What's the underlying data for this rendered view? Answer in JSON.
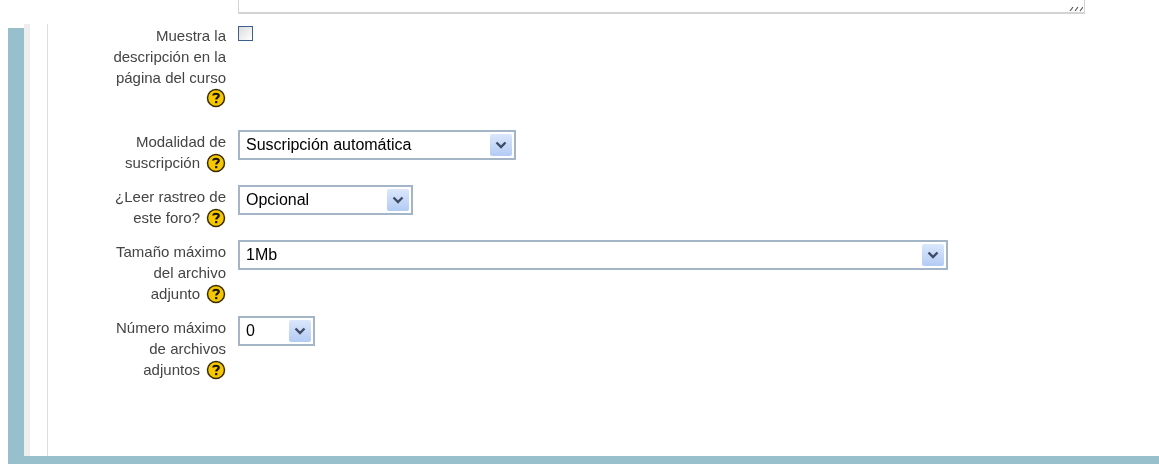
{
  "fields": [
    {
      "kind": "checkbox",
      "label_lines": [
        "Muestra la",
        "descripción en la",
        "página del curso"
      ],
      "checked": false
    },
    {
      "kind": "select",
      "label_lines": [
        "Modalidad de",
        "suscripción"
      ],
      "value": "Suscripción automática"
    },
    {
      "kind": "select",
      "label_lines": [
        "¿Leer rastreo de",
        "este foro?"
      ],
      "value": "Opcional"
    },
    {
      "kind": "select",
      "label_lines": [
        "Tamaño máximo",
        "del archivo",
        "adjunto"
      ],
      "value": "1Mb"
    },
    {
      "kind": "select",
      "label_lines": [
        "Número máximo",
        "de archivos",
        "adjuntos"
      ],
      "value": "0"
    }
  ]
}
